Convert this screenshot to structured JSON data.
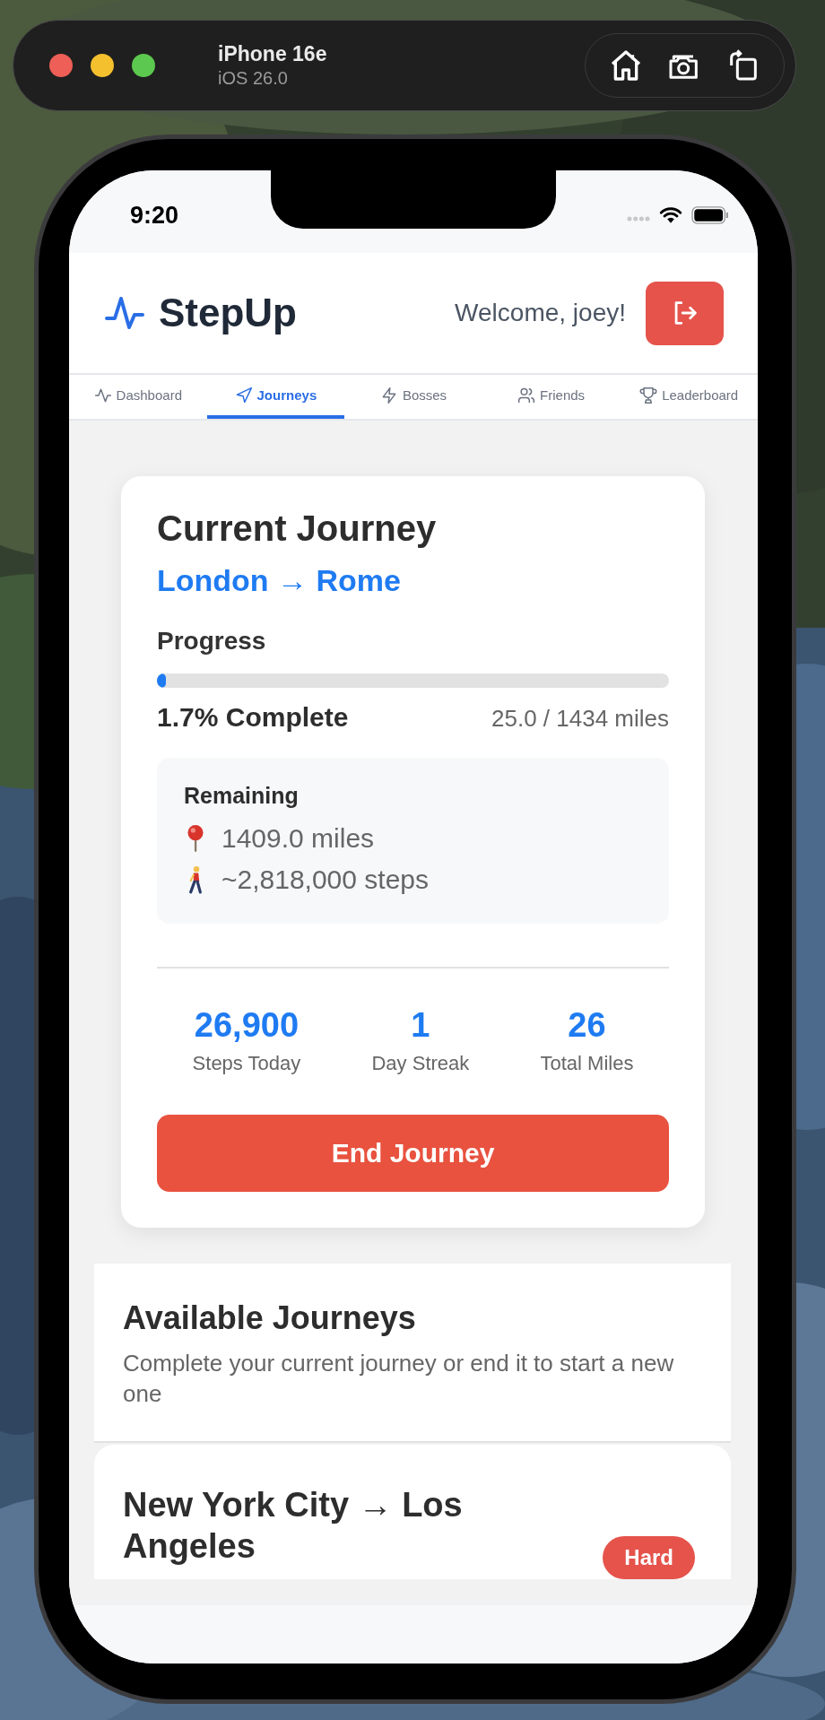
{
  "simulator": {
    "device": "iPhone 16e",
    "os": "iOS 26.0"
  },
  "status_bar": {
    "time": "9:20"
  },
  "header": {
    "app_name": "StepUp",
    "welcome": "Welcome, joey!"
  },
  "tabs": [
    {
      "label": "Dashboard",
      "selected": false
    },
    {
      "label": "Journeys",
      "selected": true
    },
    {
      "label": "Bosses",
      "selected": false
    },
    {
      "label": "Friends",
      "selected": false
    },
    {
      "label": "Leaderboard",
      "selected": false
    }
  ],
  "current_journey": {
    "title": "Current Journey",
    "route": "London → Rome",
    "progress_label": "Progress",
    "level": 0.017,
    "percent": "1.7% Complete",
    "distance": "25.0 / 1434 miles",
    "remaining": {
      "title": "Remaining",
      "items": [
        {
          "kind": "distance",
          "text": "1409.0 miles"
        },
        {
          "kind": "steps",
          "text": "~2,818,000 steps"
        }
      ]
    },
    "stats": [
      {
        "value": "26,900",
        "label": "Steps Today"
      },
      {
        "value": "1",
        "label": "Day Streak"
      },
      {
        "value": "26",
        "label": "Total Miles"
      }
    ],
    "button": "End Journey"
  },
  "available": {
    "title": "Available Journeys",
    "subtitle": "Complete your current journey or end it to start a new one",
    "journeys": [
      {
        "route": "New York City → Los Angeles",
        "difficulty": "Hard",
        "color": "#e5534b"
      }
    ]
  }
}
